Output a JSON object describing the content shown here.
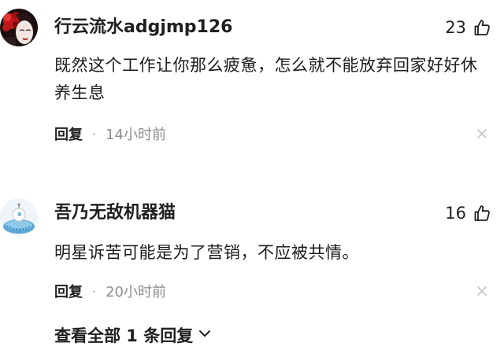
{
  "comments": [
    {
      "username": "行云流水adgjmp126",
      "likes": "23",
      "text": "既然这个工作让你那么疲惫，怎么就不能放弃回家好好休养生息",
      "reply_label": "回复",
      "separator": "·",
      "time": "14小时前",
      "avatar_icon": "red-floral-portrait-avatar"
    },
    {
      "username": "吾乃无敌机器猫",
      "likes": "16",
      "text": "明星诉苦可能是为了营销，不应被共情。",
      "reply_label": "回复",
      "separator": "·",
      "time": "20小时前",
      "avatar_icon": "blue-robot-cat-avatar"
    }
  ],
  "view_all_replies": "查看全部 1 条回复",
  "colors": {
    "text_primary": "#1f1f1f",
    "text_secondary": "#8f8f8f",
    "avatar_robot_blue": "#5aa7d6"
  }
}
